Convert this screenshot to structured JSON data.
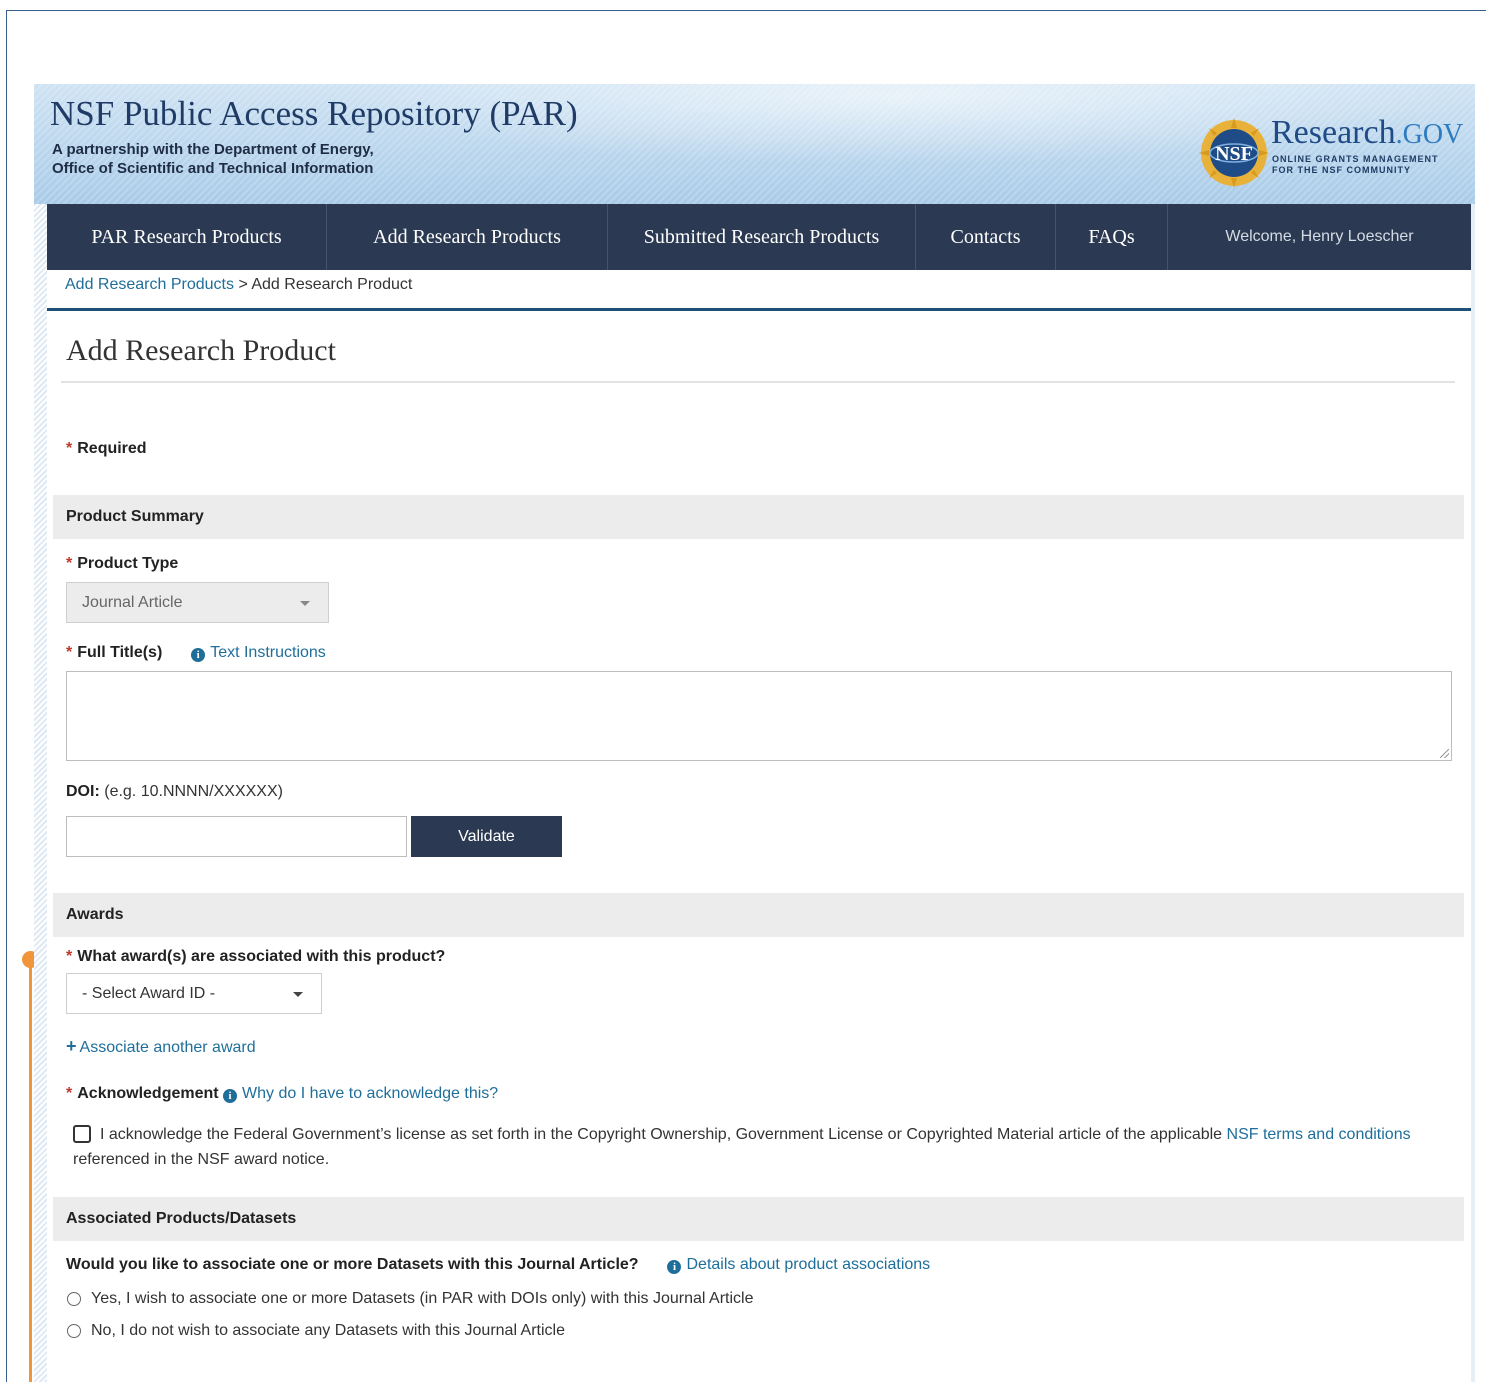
{
  "banner": {
    "title": "NSF Public Access Repository (PAR)",
    "subtitle_line1": "A partnership with the Department of Energy,",
    "subtitle_line2": "Office of Scientific and Technical Information",
    "logo_seal_text": "NSF",
    "logo_name": "Research",
    "logo_suffix": ".GOV",
    "logo_tagline1": "ONLINE GRANTS MANAGEMENT",
    "logo_tagline2": "FOR THE NSF COMMUNITY"
  },
  "nav": {
    "items": [
      {
        "label": "PAR Research Products"
      },
      {
        "label": "Add Research Products"
      },
      {
        "label": "Submitted Research Products"
      },
      {
        "label": "Contacts"
      },
      {
        "label": "FAQs"
      }
    ],
    "welcome": "Welcome, Henry Loescher"
  },
  "breadcrumb": {
    "parent": "Add Research Products",
    "separator": ">",
    "current": "Add Research Product"
  },
  "page_title": "Add Research Product",
  "required_marker": "*",
  "required_label": "Required",
  "product_summary": {
    "section_title": "Product Summary",
    "product_type_label": "Product Type",
    "product_type_value": "Journal Article",
    "full_title_label": "Full Title(s)",
    "text_instructions_link": "Text Instructions",
    "full_title_value": "",
    "doi_label": "DOI:",
    "doi_hint": "(e.g. 10.NNNN/XXXXXX)",
    "doi_value": "",
    "validate_button": "Validate"
  },
  "awards": {
    "section_title": "Awards",
    "question": "What award(s) are associated with this product?",
    "award_select_value": "- Select Award ID -",
    "associate_link": "Associate another award",
    "acknowledgement_label": "Acknowledgement",
    "why_link": "Why do I have to acknowledge this?",
    "ack_text_before": "I acknowledge the Federal Government’s license as set forth in the Copyright Ownership, Government License or Copyrighted Material article of the applicable ",
    "ack_link": "NSF terms and conditions",
    "ack_text_after": " referenced in the NSF award notice.",
    "ack_checked": false
  },
  "associated": {
    "section_title": "Associated Products/Datasets",
    "question": "Would you like to associate one or more Datasets with this Journal Article?",
    "details_link": "Details about product associations",
    "options": [
      {
        "label": "Yes, I wish to associate one or more Datasets (in PAR with DOIs only) with this Journal Article"
      },
      {
        "label": "No, I do not wish to associate any Datasets with this Journal Article"
      }
    ]
  },
  "colors": {
    "nav_bg": "#2b3a52",
    "link": "#1f6e9a",
    "required": "#c0392b",
    "progress": "#f0953a"
  }
}
